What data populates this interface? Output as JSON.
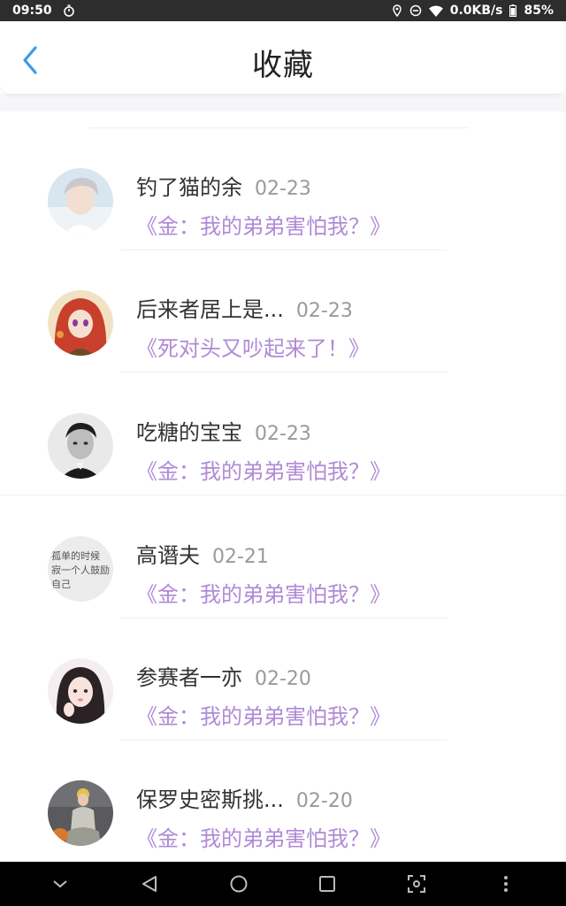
{
  "status_bar": {
    "time": "09:50",
    "network_speed": "0.0KB/s",
    "battery": "85%"
  },
  "header": {
    "title": "收藏",
    "back_icon": "chevron-left-icon"
  },
  "colors": {
    "accent": "#3a9ae8",
    "post_title": "#b08ad6",
    "date": "#9a9a9a",
    "name": "#333333"
  },
  "favorites": [
    {
      "name": "钓了猫的余",
      "date": "02-23",
      "post_title": "《金：我的弟弟害怕我？》"
    },
    {
      "name": "后来者居上是...",
      "date": "02-23",
      "post_title": "《死对头又吵起来了！》"
    },
    {
      "name": "吃糖的宝宝",
      "date": "02-23",
      "post_title": "《金：我的弟弟害怕我？》"
    },
    {
      "name": "高谮夫",
      "date": "02-21",
      "post_title": "《金：我的弟弟害怕我？》"
    },
    {
      "name": "参赛者一亦",
      "date": "02-20",
      "post_title": "《金：我的弟弟害怕我？》"
    },
    {
      "name": "保罗史密斯挑...",
      "date": "02-20",
      "post_title": "《金：我的弟弟害怕我？》"
    }
  ],
  "avatar_handwriting": "孤单的时候\n寂一个人鼓励\n自己",
  "nav_bar": {
    "icons": [
      "chevron-down-icon",
      "back-triangle-icon",
      "home-circle-icon",
      "recents-square-icon",
      "scan-icon",
      "more-vertical-icon"
    ]
  }
}
